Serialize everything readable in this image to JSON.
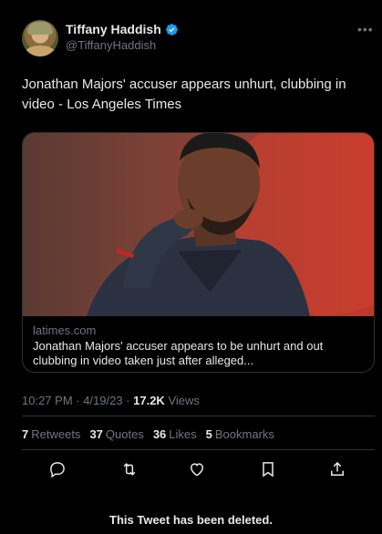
{
  "author": {
    "display_name": "Tiffany Haddish",
    "handle": "@TiffanyHaddish",
    "verified_icon": "verified-badge-icon",
    "verified_color": "#1d9bf0"
  },
  "tweet": {
    "text": "Jonathan Majors' accuser appears unhurt, clubbing in video - Los Angeles Times"
  },
  "card": {
    "domain": "latimes.com",
    "title": "Jonathan Majors' accuser appears to be unhurt and out clubbing in video taken just after alleged..."
  },
  "meta": {
    "timestamp": "10:27 PM · 4/19/23 · ",
    "views_count": "17.2K",
    "views_label": " Views"
  },
  "stats": [
    {
      "count": "7",
      "label": "Retweets"
    },
    {
      "count": "37",
      "label": "Quotes"
    },
    {
      "count": "36",
      "label": "Likes"
    },
    {
      "count": "5",
      "label": "Bookmarks"
    }
  ],
  "actions": [
    "reply-icon",
    "retweet-icon",
    "like-icon",
    "bookmark-icon",
    "share-icon"
  ],
  "footer": {
    "deleted_notice": "This Tweet has been deleted."
  },
  "colors": {
    "background": "#000000",
    "text_primary": "#e7e9ea",
    "text_secondary": "#71767b",
    "border": "#2f3336"
  }
}
